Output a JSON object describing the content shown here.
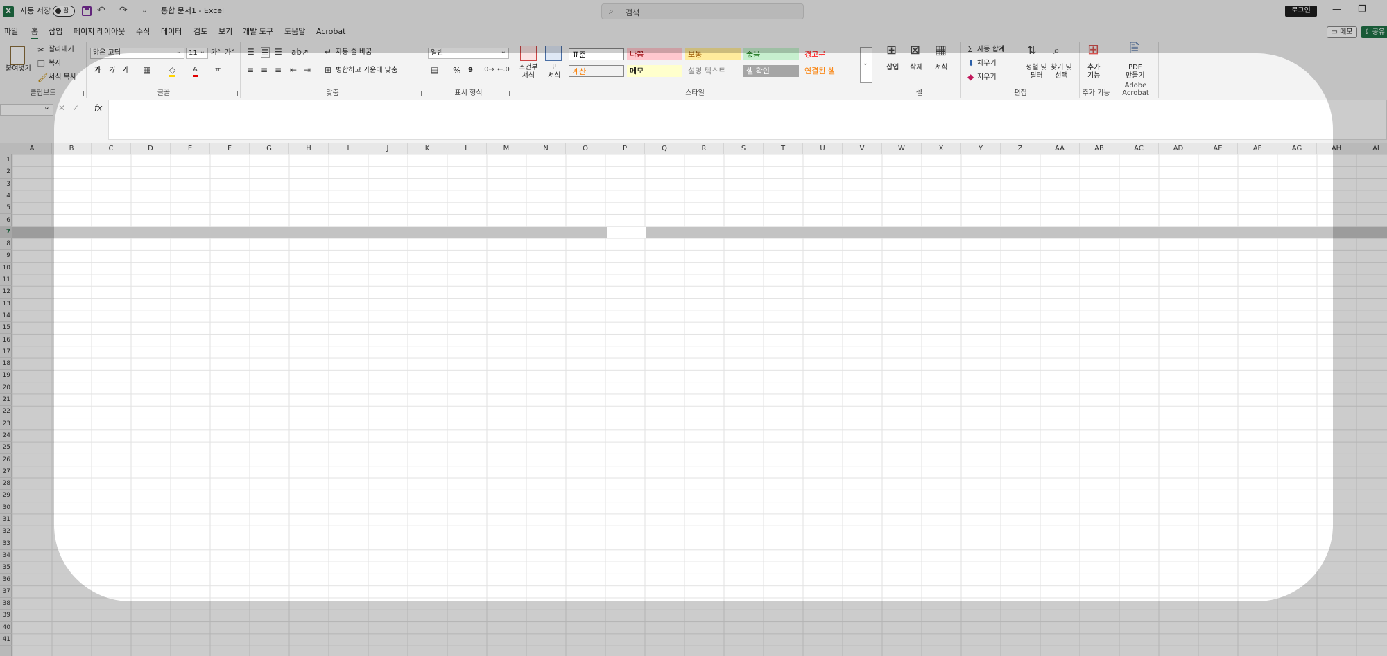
{
  "titlebar": {
    "logo": "X",
    "autosave_label": "자동 저장",
    "autosave_state": "끔",
    "undo_glyph": "↶",
    "redo_glyph": "↷",
    "qat_more": "⌄",
    "doc_title": "통합 문서1  -  Excel",
    "search_placeholder": "검색",
    "login": "로그인",
    "minimize": "—",
    "restore": "❐"
  },
  "menu_tabs": [
    "파일",
    "홈",
    "삽입",
    "페이지 레이아웃",
    "수식",
    "데이터",
    "검토",
    "보기",
    "개발 도구",
    "도움말",
    "Acrobat"
  ],
  "memo_button": "메모",
  "share_button": "공유",
  "ribbon": {
    "clipboard": {
      "paste": "붙여넣기",
      "cut": "잘라내기",
      "copy": "복사",
      "format_painter": "서식 복사",
      "label": "클립보드"
    },
    "font": {
      "font_name": "맑은 고딕",
      "font_size": "11",
      "grow": "가ˆ",
      "shrink": "가ˇ",
      "bold": "가",
      "italic": "가",
      "underline": "가",
      "label": "글꼴"
    },
    "alignment": {
      "wrap_text": "자동 줄 바꿈",
      "merge_center": "병합하고 가운데 맞춤",
      "label": "맞춤"
    },
    "number": {
      "format": "일반",
      "percent": "%",
      "comma": "9",
      "label": "표시 형식"
    },
    "styles": {
      "conditional": "조건부\n서식",
      "table": "표\n서식",
      "cells": [
        {
          "text": "표준",
          "bg": "#ffffff",
          "fg": "#000000"
        },
        {
          "text": "나쁨",
          "bg": "#ffc7ce",
          "fg": "#9c0006"
        },
        {
          "text": "보통",
          "bg": "#ffeb9c",
          "fg": "#9c5700"
        },
        {
          "text": "좋음",
          "bg": "#c6efce",
          "fg": "#006100"
        },
        {
          "text": "경고문",
          "bg": "#f3f3f3",
          "fg": "#ff0000"
        },
        {
          "text": "계산",
          "bg": "#f2f2f2",
          "fg": "#fa7d00"
        },
        {
          "text": "메모",
          "bg": "#ffffcc",
          "fg": "#000000"
        },
        {
          "text": "설명 텍스트",
          "bg": "#f3f3f3",
          "fg": "#7f7f7f"
        },
        {
          "text": "셀 확인",
          "bg": "#a5a5a5",
          "fg": "#ffffff"
        },
        {
          "text": "연결된 셀",
          "bg": "#f3f3f3",
          "fg": "#fa7d00"
        }
      ],
      "label": "스타일"
    },
    "cells_group": {
      "insert": "삽입",
      "delete": "삭제",
      "format": "서식",
      "label": "셀"
    },
    "editing": {
      "autosum": "자동 합계",
      "fill": "채우기",
      "clear": "지우기",
      "sort_filter": "정렬 및\n필터",
      "find_select": "찾기 및\n선택",
      "label": "편집"
    },
    "addins": {
      "btn": "추가\n기능",
      "label": "추가 기능"
    },
    "acrobat": {
      "btn": "PDF\n만들기",
      "label": "Adobe Acrobat"
    }
  },
  "formula_bar": {
    "fx": "fx",
    "cancel": "✕",
    "enter": "✓"
  },
  "columns": [
    "A",
    "B",
    "C",
    "D",
    "E",
    "F",
    "G",
    "H",
    "I",
    "J",
    "K",
    "L",
    "M",
    "N",
    "O",
    "P",
    "Q",
    "R",
    "S",
    "T",
    "U",
    "V",
    "W",
    "X",
    "Y",
    "Z",
    "AA",
    "AB",
    "AC",
    "AD",
    "AE",
    "AF",
    "AG",
    "AH",
    "AI"
  ],
  "rows": [
    "1",
    "2",
    "3",
    "4",
    "5",
    "6",
    "7",
    "8",
    "9",
    "10",
    "11",
    "12",
    "13",
    "14",
    "15",
    "16",
    "17",
    "18",
    "19",
    "20",
    "21",
    "22",
    "23",
    "24",
    "25",
    "26",
    "27",
    "28",
    "29",
    "30",
    "31",
    "32",
    "33",
    "34",
    "35",
    "36",
    "37",
    "38",
    "39",
    "40",
    "41"
  ],
  "selected_row": "7",
  "accent_color": "#1e7145"
}
